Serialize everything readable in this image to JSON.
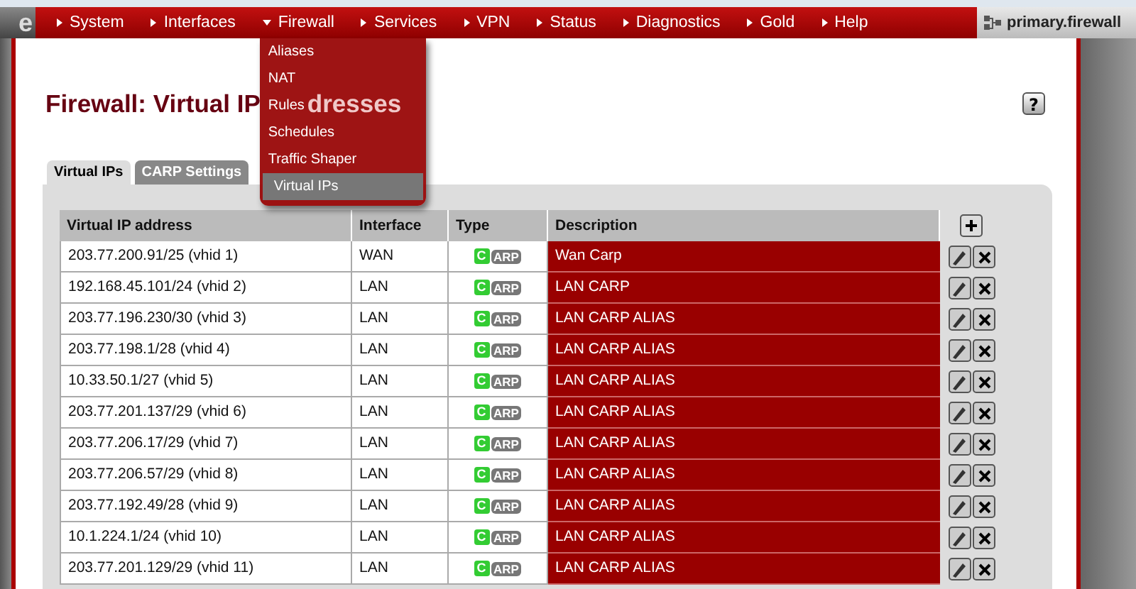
{
  "logo": {
    "text": "e"
  },
  "nav": {
    "items": [
      {
        "label": "System",
        "expanded": false
      },
      {
        "label": "Interfaces",
        "expanded": false
      },
      {
        "label": "Firewall",
        "expanded": true
      },
      {
        "label": "Services",
        "expanded": false
      },
      {
        "label": "VPN",
        "expanded": false
      },
      {
        "label": "Status",
        "expanded": false
      },
      {
        "label": "Diagnostics",
        "expanded": false
      },
      {
        "label": "Gold",
        "expanded": false
      },
      {
        "label": "Help",
        "expanded": false
      }
    ],
    "host": "primary.firewall"
  },
  "menu": {
    "items": [
      {
        "label": "Aliases",
        "selected": false
      },
      {
        "label": "NAT",
        "selected": false
      },
      {
        "label": "Rules",
        "selected": false
      },
      {
        "label": "Schedules",
        "selected": false
      },
      {
        "label": "Traffic Shaper",
        "selected": false
      },
      {
        "label": "Virtual IPs",
        "selected": true
      }
    ]
  },
  "page": {
    "title_parts": [
      "Firewall: Virtual IP",
      "dresses"
    ],
    "help": "?"
  },
  "tabs": [
    {
      "label": "Virtual IPs",
      "selected": true
    },
    {
      "label": "CARP Settings",
      "selected": false
    }
  ],
  "table": {
    "columns": [
      "Virtual IP address",
      "Interface",
      "Type",
      "Description"
    ],
    "rows": [
      {
        "address": "203.77.200.91/25 (vhid 1)",
        "interface": "WAN",
        "type_mark": "C",
        "type": "ARP",
        "description": "Wan Carp"
      },
      {
        "address": "192.168.45.101/24 (vhid 2)",
        "interface": "LAN",
        "type_mark": "C",
        "type": "ARP",
        "description": "LAN CARP"
      },
      {
        "address": "203.77.196.230/30 (vhid 3)",
        "interface": "LAN",
        "type_mark": "C",
        "type": "ARP",
        "description": "LAN CARP ALIAS"
      },
      {
        "address": "203.77.198.1/28 (vhid 4)",
        "interface": "LAN",
        "type_mark": "C",
        "type": "ARP",
        "description": "LAN CARP ALIAS"
      },
      {
        "address": "10.33.50.1/27 (vhid 5)",
        "interface": "LAN",
        "type_mark": "C",
        "type": "ARP",
        "description": "LAN CARP ALIAS"
      },
      {
        "address": "203.77.201.137/29 (vhid 6)",
        "interface": "LAN",
        "type_mark": "C",
        "type": "ARP",
        "description": "LAN CARP ALIAS"
      },
      {
        "address": "203.77.206.17/29 (vhid 7)",
        "interface": "LAN",
        "type_mark": "C",
        "type": "ARP",
        "description": "LAN CARP ALIAS"
      },
      {
        "address": "203.77.206.57/29 (vhid 8)",
        "interface": "LAN",
        "type_mark": "C",
        "type": "ARP",
        "description": "LAN CARP ALIAS"
      },
      {
        "address": "203.77.192.49/28 (vhid 9)",
        "interface": "LAN",
        "type_mark": "C",
        "type": "ARP",
        "description": "LAN CARP ALIAS"
      },
      {
        "address": "10.1.224.1/24 (vhid 10)",
        "interface": "LAN",
        "type_mark": "C",
        "type": "ARP",
        "description": "LAN CARP ALIAS"
      },
      {
        "address": "203.77.201.129/29 (vhid 11)",
        "interface": "LAN",
        "type_mark": "C",
        "type": "ARP",
        "description": "LAN CARP ALIAS"
      }
    ]
  }
}
